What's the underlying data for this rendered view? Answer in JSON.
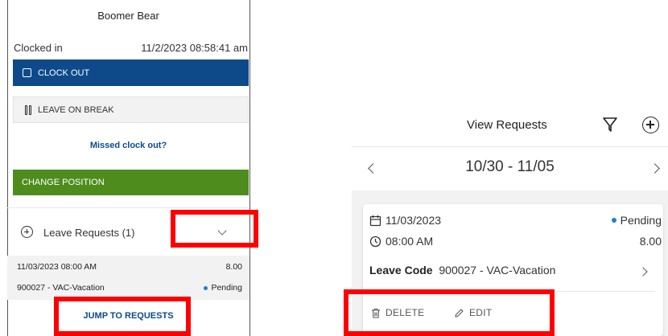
{
  "left_panel": {
    "user_name": "Boomer Bear",
    "clock_status": "Clocked in",
    "clock_timestamp": "11/2/2023 08:58:41 am",
    "clock_out_label": "CLOCK OUT",
    "leave_on_break_label": "LEAVE ON BREAK",
    "missed_clock_out_label": "Missed clock out?",
    "change_position_label": "CHANGE POSITION",
    "leave_requests_label": "Leave Requests (1)",
    "leave_request": {
      "datetime": "11/03/2023 08:00 AM",
      "hours": "8.00",
      "leave_code": "900027 - VAC-Vacation",
      "status": "Pending"
    },
    "jump_to_requests_label": "JUMP TO REQUESTS"
  },
  "right_panel": {
    "title": "View Requests",
    "date_range": "10/30 - 11/05",
    "request": {
      "date": "11/03/2023",
      "time": "08:00 AM",
      "status": "Pending",
      "hours": "8.00",
      "leave_code_label": "Leave Code",
      "leave_code_value": "900027 - VAC-Vacation",
      "delete_label": "DELETE",
      "edit_label": "EDIT"
    }
  },
  "colors": {
    "clock_out_bg": "#0e4a8a",
    "change_position_bg": "#4e8d1d",
    "link": "#0e4a8a",
    "pending_dot": "#1e7ed4",
    "highlight": "#ff0000"
  },
  "icons": {
    "clock_out": "square-icon",
    "break": "pause-icon",
    "leave_requests": "plus-circle-icon",
    "expand": "chevron-down-icon",
    "filter": "filter-icon",
    "add": "plus-circle-icon",
    "prev": "chevron-left-icon",
    "next": "chevron-right-icon",
    "date": "calendar-icon",
    "time": "clock-icon",
    "delete": "trash-icon",
    "edit": "pencil-icon"
  }
}
